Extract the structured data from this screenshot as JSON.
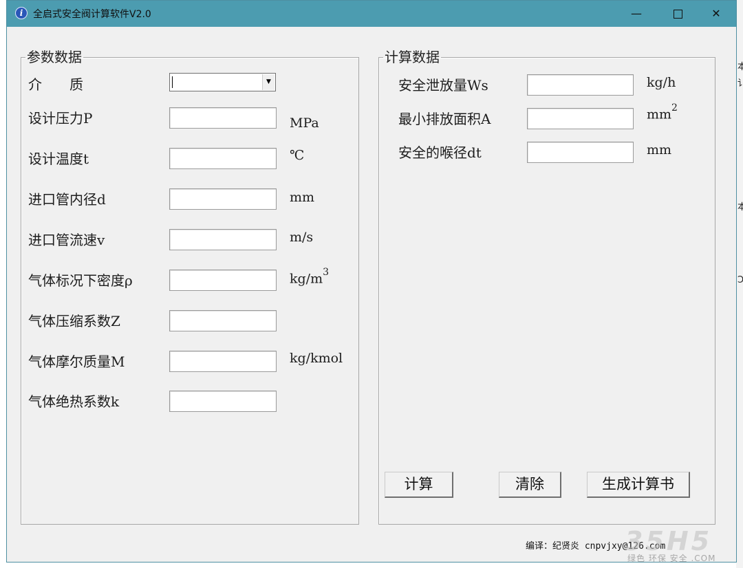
{
  "window": {
    "title": "全启式安全阀计算软件V2.0",
    "minimize": "—",
    "close": "✕"
  },
  "params": {
    "legend": "参数数据",
    "medium_label": "介　　质",
    "medium_value": "",
    "rows": [
      {
        "label": "设计压力P",
        "unit": "MPa",
        "value": ""
      },
      {
        "label": "设计温度t",
        "unit": "℃",
        "value": ""
      },
      {
        "label": "进口管内径d",
        "unit": "mm",
        "value": ""
      },
      {
        "label": "进口管流速v",
        "unit": "m/s",
        "value": ""
      },
      {
        "label": "气体标况下密度ρ",
        "unit": "kg/m",
        "unit_sup": "3",
        "value": ""
      },
      {
        "label": "气体压缩系数Z",
        "unit": "",
        "value": ""
      },
      {
        "label": "气体摩尔质量M",
        "unit": "kg/kmol",
        "value": ""
      },
      {
        "label": "气体绝热系数k",
        "unit": "",
        "value": ""
      }
    ]
  },
  "results": {
    "legend": "计算数据",
    "rows": [
      {
        "label": "安全泄放量Ws",
        "unit": "kg/h",
        "value": ""
      },
      {
        "label": "最小排放面积A",
        "unit": "mm",
        "unit_sup": "2",
        "value": ""
      },
      {
        "label": "安全的喉径dt",
        "unit": "mm",
        "value": ""
      }
    ]
  },
  "buttons": {
    "calculate": "计算",
    "clear": "清除",
    "report": "生成计算书"
  },
  "footer": {
    "author": "编译：纪贤炎 cnpvjxy@126.com"
  },
  "background": {
    "side_chars": [
      "本",
      "讠",
      "本",
      "Ↄ"
    ]
  },
  "watermark": {
    "main": "35H5",
    "sub": "绿色 环保 安全 .COM"
  }
}
